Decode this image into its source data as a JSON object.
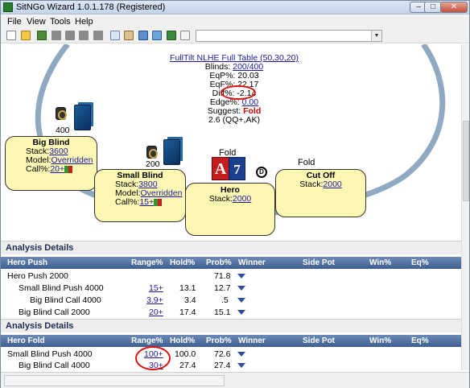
{
  "window": {
    "title": "SitNGo Wizard 1.0.1.178 (Registered)",
    "min_label": "–",
    "max_label": "□",
    "close_label": "✕"
  },
  "menu": [
    "File",
    "View",
    "Tools",
    "Help"
  ],
  "toolbar": {
    "buttons": [
      "new-icon",
      "open-icon",
      "home-icon",
      "gray-icon",
      "gray-icon",
      "gray-icon",
      "gray-icon",
      "copy-icon",
      "paste-icon",
      "image-icon",
      "export-icon",
      "check-icon",
      "document-icon"
    ],
    "select_value": ""
  },
  "table_info": {
    "name": "FullTilt NLHE Full Table (50,30,20)",
    "blinds_label": "Blinds:",
    "blinds_value": "200/400",
    "eqp_label": "EqP%:",
    "eqp_value": "20.03",
    "eqf_label": "EqF%:",
    "eqf_value": "22.17",
    "diff_label": "Diff%:",
    "diff_value": "-2.14",
    "edge_label": "Edge%:",
    "edge_value": "0.00",
    "suggest_label": "Suggest:",
    "suggest_value": "Fold",
    "range_text": "2.6 (QQ+,AK)"
  },
  "seats": {
    "big_blind": {
      "title": "Big Blind",
      "stack_label": "Stack:",
      "stack": "3600",
      "model_label": "Model:",
      "model": "Overridden",
      "call_label": "Call%:",
      "call": "20+",
      "bet": "400"
    },
    "small_blind": {
      "title": "Small Blind",
      "stack_label": "Stack:",
      "stack": "3800",
      "model_label": "Model:",
      "model": "Overridden",
      "call_label": "Call%:",
      "call": "15+",
      "bet": "200"
    },
    "hero": {
      "title": "Hero",
      "stack_label": "Stack:",
      "stack": "2000",
      "action": "Fold",
      "card1": "A",
      "card2": "7",
      "dealer": "D"
    },
    "cut_off": {
      "title": "Cut Off",
      "stack_label": "Stack:",
      "stack": "2000",
      "action": "Fold"
    }
  },
  "analysis1": {
    "section": "Analysis Details",
    "headers": [
      "Hero Push",
      "Range%",
      "Hold%",
      "Prob%",
      "Winner",
      "Side Pot",
      "Win%",
      "Eq%"
    ],
    "rows": [
      {
        "name": "Hero Push 2000",
        "range": "",
        "hold": "",
        "prob": "71.8"
      },
      {
        "name": "Small Blind Push 4000",
        "range": "15+",
        "hold": "13.1",
        "prob": "12.7"
      },
      {
        "name": "Big Blind Call 4000",
        "range": "3.9+",
        "hold": "3.4",
        "prob": ".5"
      },
      {
        "name": "Big Blind Call 2000",
        "range": "20+",
        "hold": "17.4",
        "prob": "15.1"
      }
    ]
  },
  "analysis2": {
    "section": "Analysis Details",
    "headers": [
      "Hero Fold",
      "Range%",
      "Hold%",
      "Prob%",
      "Winner",
      "Side Pot",
      "Win%",
      "Eq%"
    ],
    "rows": [
      {
        "name": "Small Blind Push 4000",
        "range": "100+",
        "hold": "100.0",
        "prob": "72.6"
      },
      {
        "name": "Big Blind Call 4000",
        "range": "30+",
        "hold": "27.4",
        "prob": "27.4"
      }
    ]
  },
  "colors": {
    "seat_fill": "#fcf8b4",
    "table_rail": "#8fa9c2",
    "header_blue": "#4f6fa0",
    "highlight_red": "#e01010",
    "link_blue": "#1a1aa6"
  }
}
